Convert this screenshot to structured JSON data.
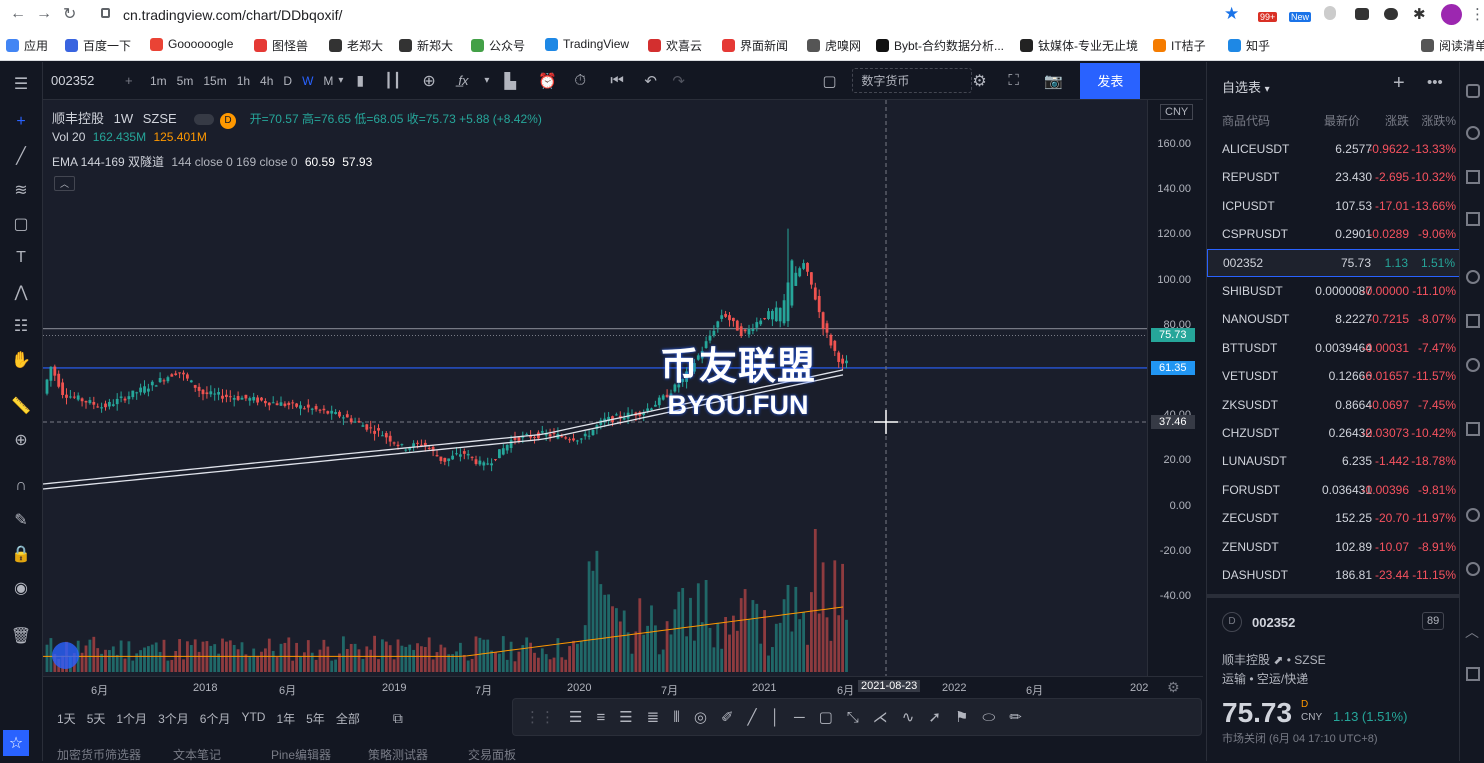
{
  "browser": {
    "url": "cn.tradingview.com/chart/DDbqoxif/",
    "badge1": "99+",
    "badge2": "New"
  },
  "bookmarks": [
    {
      "label": "应用",
      "color": "#4285f4"
    },
    {
      "label": "百度一下",
      "color": "#3964e0"
    },
    {
      "label": "Goooooogle",
      "color": "#ea4335"
    },
    {
      "label": "图怪兽",
      "color": "#e53935"
    },
    {
      "label": "老郑大",
      "color": "#333"
    },
    {
      "label": "新郑大",
      "color": "#333"
    },
    {
      "label": "公众号",
      "color": "#43a047"
    },
    {
      "label": "TradingView",
      "color": "#1e88e5"
    },
    {
      "label": "欢喜云",
      "color": "#d32f2f"
    },
    {
      "label": "界面新闻",
      "color": "#e53935"
    },
    {
      "label": "虎嗅网",
      "color": "#555"
    },
    {
      "label": "Bybt-合约数据分析...",
      "color": "#111"
    },
    {
      "label": "钛媒体-专业无止境",
      "color": "#222"
    },
    {
      "label": "IT桔子",
      "color": "#f57c00"
    },
    {
      "label": "知乎",
      "color": "#1e88e5"
    },
    {
      "label": "阅读清单",
      "color": "#555"
    }
  ],
  "toolbar": {
    "symbol": "002352",
    "intervals": [
      "1m",
      "5m",
      "15m",
      "1h",
      "4h",
      "D",
      "W",
      "M"
    ],
    "active_interval": "W",
    "fx": "f̲x",
    "market": "数字货币",
    "publish": "发表"
  },
  "legend": {
    "name": "顺丰控股",
    "interval": "1W",
    "exchange": "SZSE",
    "badge": "D",
    "ohlc": "开=70.57 高=76.65 低=68.05 收=75.73 +5.88 (+8.42%)",
    "vol_label": "Vol 20",
    "vol_v1": "162.435M",
    "vol_v2": "125.401M",
    "ema_label": "EMA 144-169 双隧道",
    "ema_params": "144 close 0 169 close 0",
    "ema_v1": "60.59",
    "ema_v2": "57.93"
  },
  "axis": {
    "currency": "CNY",
    "ticks": [
      "160.00",
      "140.00",
      "120.00",
      "100.00",
      "80.00",
      "60.00",
      "40.00",
      "20.00",
      "0.00",
      "-20.00",
      "-40.00"
    ],
    "labels": [
      {
        "text": "75.73",
        "color": "#26a69a"
      },
      {
        "text": "61.35",
        "color": "#2196f3"
      },
      {
        "text": "37.46",
        "color": "#363a45"
      }
    ]
  },
  "timeaxis": [
    "6月",
    "2018",
    "6月",
    "2019",
    "7月",
    "2020",
    "7月",
    "2021",
    "6月",
    "2021-08-23",
    "2022",
    "6月",
    "202"
  ],
  "ranges": [
    "1天",
    "5天",
    "1个月",
    "3个月",
    "6个月",
    "YTD",
    "1年",
    "5年",
    "全部"
  ],
  "bottomtabs": [
    "加密货币筛选器",
    "文本笔记",
    "Pine编辑器",
    "策略测试器",
    "交易面板"
  ],
  "watermark": {
    "line1": "币友联盟",
    "line2": "BYOU.FUN"
  },
  "watchlist": {
    "title": "自选表",
    "headers": [
      "商品代码",
      "最新价",
      "涨跌",
      "涨跌%"
    ],
    "rows": [
      {
        "sym": "ALICEUSDT",
        "last": "6.2577",
        "chg": "-0.9622",
        "pct": "-13.33%"
      },
      {
        "sym": "REPUSDT",
        "last": "23.430",
        "chg": "-2.695",
        "pct": "-10.32%"
      },
      {
        "sym": "ICPUSDT",
        "last": "107.53",
        "chg": "-17.01",
        "pct": "-13.66%"
      },
      {
        "sym": "CSPRUSDT",
        "last": "0.2901",
        "chg": "-0.0289",
        "pct": "-9.06%"
      },
      {
        "sym": "002352",
        "last": "75.73",
        "chg": "1.13",
        "pct": "1.51%"
      },
      {
        "sym": "SHIBUSDT",
        "last": "0.0000087",
        "chg": "-0.00000",
        "pct": "-11.10%"
      },
      {
        "sym": "NANOUSDT",
        "last": "8.2227",
        "chg": "-0.7215",
        "pct": "-8.07%"
      },
      {
        "sym": "BTTUSDT",
        "last": "0.0039464",
        "chg": "-0.00031",
        "pct": "-7.47%"
      },
      {
        "sym": "VETUSDT",
        "last": "0.12666",
        "chg": "-0.01657",
        "pct": "-11.57%"
      },
      {
        "sym": "ZKSUSDT",
        "last": "0.8664",
        "chg": "-0.0697",
        "pct": "-7.45%"
      },
      {
        "sym": "CHZUSDT",
        "last": "0.26432",
        "chg": "-0.03073",
        "pct": "-10.42%"
      },
      {
        "sym": "LUNAUSDT",
        "last": "6.235",
        "chg": "-1.442",
        "pct": "-18.78%"
      },
      {
        "sym": "FORUSDT",
        "last": "0.036431",
        "chg": "-0.00396",
        "pct": "-9.81%"
      },
      {
        "sym": "ZECUSDT",
        "last": "152.25",
        "chg": "-20.70",
        "pct": "-11.97%"
      },
      {
        "sym": "ZENUSDT",
        "last": "102.89",
        "chg": "-10.07",
        "pct": "-8.91%"
      },
      {
        "sym": "DASHUSDT",
        "last": "186.81",
        "chg": "-23.44",
        "pct": "-11.15%"
      }
    ]
  },
  "detail": {
    "symbol": "002352",
    "badge": "89",
    "name": "顺丰控股",
    "exchange": "SZSE",
    "sector": "运输 • 空运/快递",
    "price": "75.73",
    "currency": "CNY",
    "badge_d": "D",
    "change": "1.13 (1.51%)",
    "status": "市场关闭 (6月 04 17:10 UTC+8)"
  },
  "colors": {
    "up": "#26a69a",
    "down": "#ef5350",
    "accent": "#2962ff",
    "bg": "#131722"
  },
  "chart_data": {
    "type": "candlestick",
    "symbol": "002352",
    "interval": "1W",
    "ylim": [
      -40,
      160
    ],
    "last_close": 75.73,
    "horizontal_lines": [
      75.73,
      61.35,
      37.46
    ],
    "ema": [
      60.59,
      57.93
    ]
  }
}
